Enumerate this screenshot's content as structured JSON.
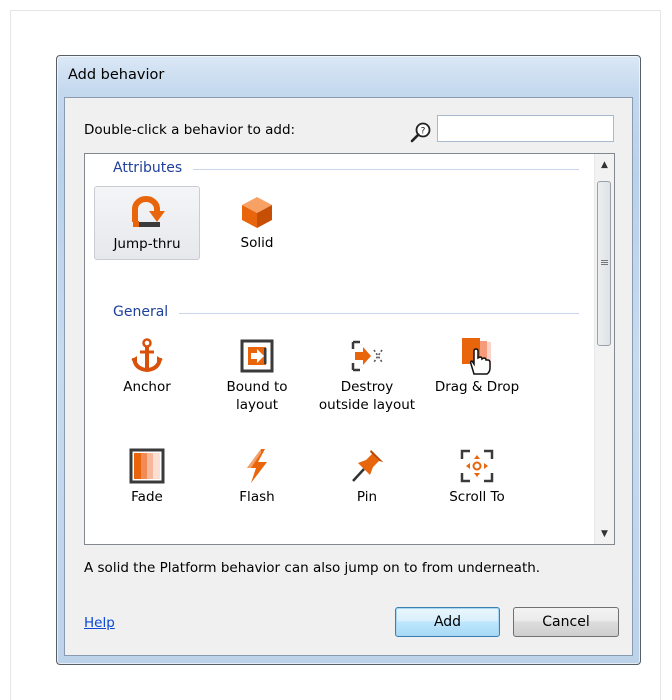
{
  "dialog": {
    "title": "Add behavior",
    "prompt": "Double-click a behavior to add:",
    "search": {
      "value": "",
      "placeholder": ""
    },
    "description": "A solid the Platform behavior can also jump on to from underneath.",
    "help_label": "Help",
    "add_label": "Add",
    "cancel_label": "Cancel"
  },
  "groups": [
    {
      "title": "Attributes",
      "items": [
        {
          "label": "Jump-thru",
          "icon": "jump-thru-icon",
          "selected": true
        },
        {
          "label": "Solid",
          "icon": "solid-cube-icon"
        }
      ]
    },
    {
      "title": "General",
      "items": [
        {
          "label": "Anchor",
          "icon": "anchor-icon"
        },
        {
          "label": "Bound to layout",
          "icon": "bound-to-layout-icon"
        },
        {
          "label": "Destroy outside layout",
          "icon": "destroy-outside-layout-icon"
        },
        {
          "label": "Drag & Drop",
          "icon": "drag-drop-icon"
        },
        {
          "label": "Fade",
          "icon": "fade-icon"
        },
        {
          "label": "Flash",
          "icon": "flash-icon"
        },
        {
          "label": "Pin",
          "icon": "pin-icon"
        },
        {
          "label": "Scroll To",
          "icon": "scroll-to-icon"
        }
      ]
    }
  ],
  "colors": {
    "accent": "#e8650c",
    "group_header": "#1e3f9a",
    "link": "#0a49d5"
  }
}
